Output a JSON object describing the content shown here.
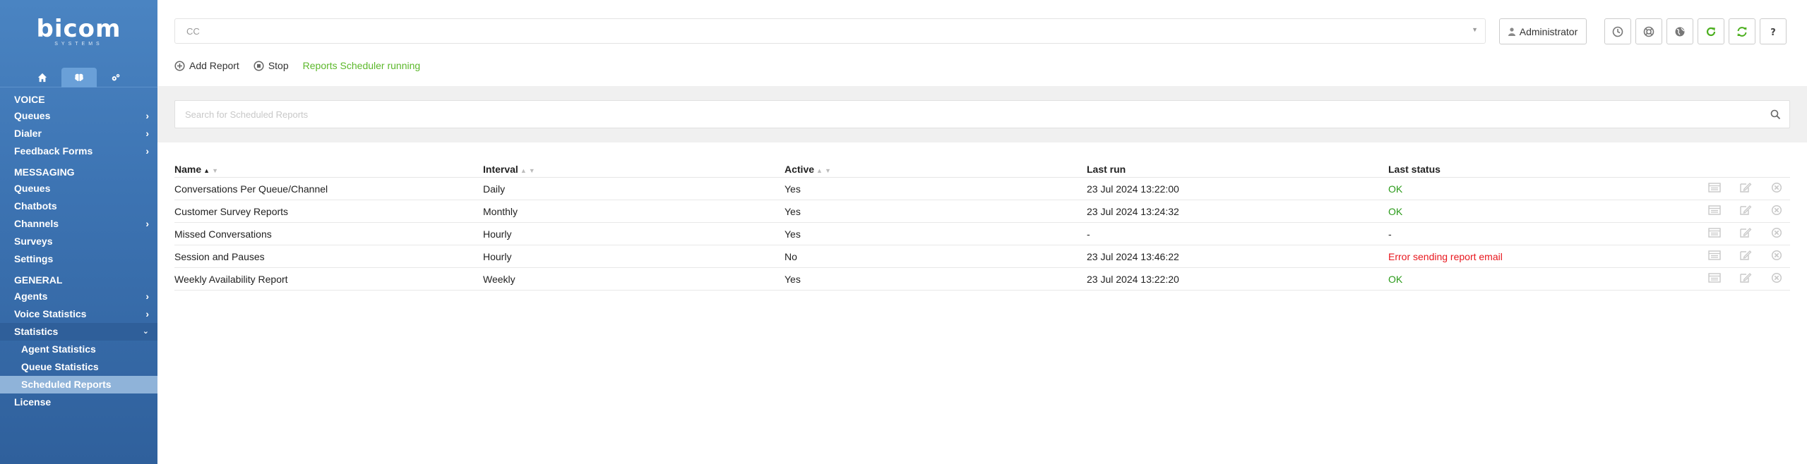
{
  "brand": {
    "name": "bicom",
    "sub": "SYSTEMS"
  },
  "sidebar": {
    "tabs": [
      {
        "icon": "home-icon"
      },
      {
        "icon": "brain-icon"
      },
      {
        "icon": "gears-icon"
      }
    ],
    "sections": {
      "voice": {
        "title": "VOICE",
        "items": [
          {
            "label": "Queues"
          },
          {
            "label": "Dialer"
          },
          {
            "label": "Feedback Forms"
          }
        ]
      },
      "messaging": {
        "title": "MESSAGING",
        "items": [
          {
            "label": "Queues"
          },
          {
            "label": "Chatbots"
          },
          {
            "label": "Channels"
          },
          {
            "label": "Surveys"
          },
          {
            "label": "Settings"
          }
        ]
      },
      "general": {
        "title": "GENERAL",
        "items": [
          {
            "label": "Agents"
          },
          {
            "label": "Voice Statistics"
          },
          {
            "label": "Statistics"
          },
          {
            "label": "Agent Statistics"
          },
          {
            "label": "Queue Statistics"
          },
          {
            "label": "Scheduled Reports"
          },
          {
            "label": "License"
          }
        ]
      }
    }
  },
  "header": {
    "tenant_value": "CC",
    "user_label": "Administrator"
  },
  "toolbar": {
    "add_label": "Add Report",
    "stop_label": "Stop",
    "status": "Reports Scheduler running"
  },
  "search": {
    "placeholder": "Search for Scheduled Reports"
  },
  "table": {
    "columns": [
      "Name",
      "Interval",
      "Active",
      "Last run",
      "Last status"
    ],
    "rows": [
      {
        "name": "Conversations Per Queue/Channel",
        "interval": "Daily",
        "active": "Yes",
        "last_run": "23 Jul 2024 13:22:00",
        "status": "OK"
      },
      {
        "name": "Customer Survey Reports",
        "interval": "Monthly",
        "active": "Yes",
        "last_run": "23 Jul 2024 13:24:32",
        "status": "OK"
      },
      {
        "name": "Missed Conversations",
        "interval": "Hourly",
        "active": "Yes",
        "last_run": "-",
        "status": "-"
      },
      {
        "name": "Session and Pauses",
        "interval": "Hourly",
        "active": "No",
        "last_run": "23 Jul 2024 13:46:22",
        "status": "Error sending report email"
      },
      {
        "name": "Weekly Availability Report",
        "interval": "Weekly",
        "active": "Yes",
        "last_run": "23 Jul 2024 13:22:20",
        "status": "OK"
      }
    ]
  },
  "colors": {
    "ok": "#2a9a19",
    "error": "#e8171e",
    "running": "#5cb82b",
    "sidebar": "#3d74b3"
  }
}
